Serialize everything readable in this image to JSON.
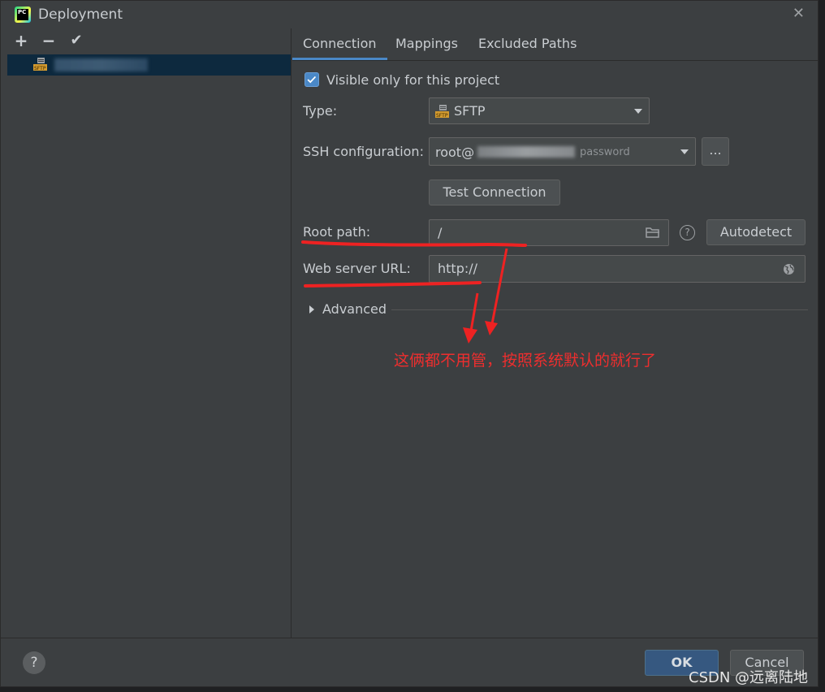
{
  "window": {
    "title": "Deployment"
  },
  "left_toolbar": {
    "add": "+",
    "remove": "−",
    "apply": "✔"
  },
  "tabs": [
    {
      "label": "Connection",
      "active": true
    },
    {
      "label": "Mappings",
      "active": false
    },
    {
      "label": "Excluded Paths",
      "active": false
    }
  ],
  "connection": {
    "visible_only_label": "Visible only for this project",
    "visible_only_checked": true,
    "type_label": "Type:",
    "type_value": "SFTP",
    "ssh_label": "SSH configuration:",
    "ssh_value_prefix": "root@",
    "ssh_value_suffix": "password",
    "ssh_more_button": "...",
    "test_connection_button": "Test Connection",
    "root_path_label": "Root path:",
    "root_path_value": "/",
    "autodetect_button": "Autodetect",
    "web_url_label": "Web server URL:",
    "web_url_value": "http://",
    "advanced_label": "Advanced"
  },
  "annotation": {
    "text": "这俩都不用管，按照系统默认的就行了"
  },
  "footer": {
    "help": "?",
    "ok": "OK",
    "cancel": "Cancel"
  },
  "watermark": "CSDN @远离陆地",
  "colors": {
    "accent": "#4a88c7",
    "annotation": "#ee2e2e",
    "selected_row": "#0d293e"
  }
}
